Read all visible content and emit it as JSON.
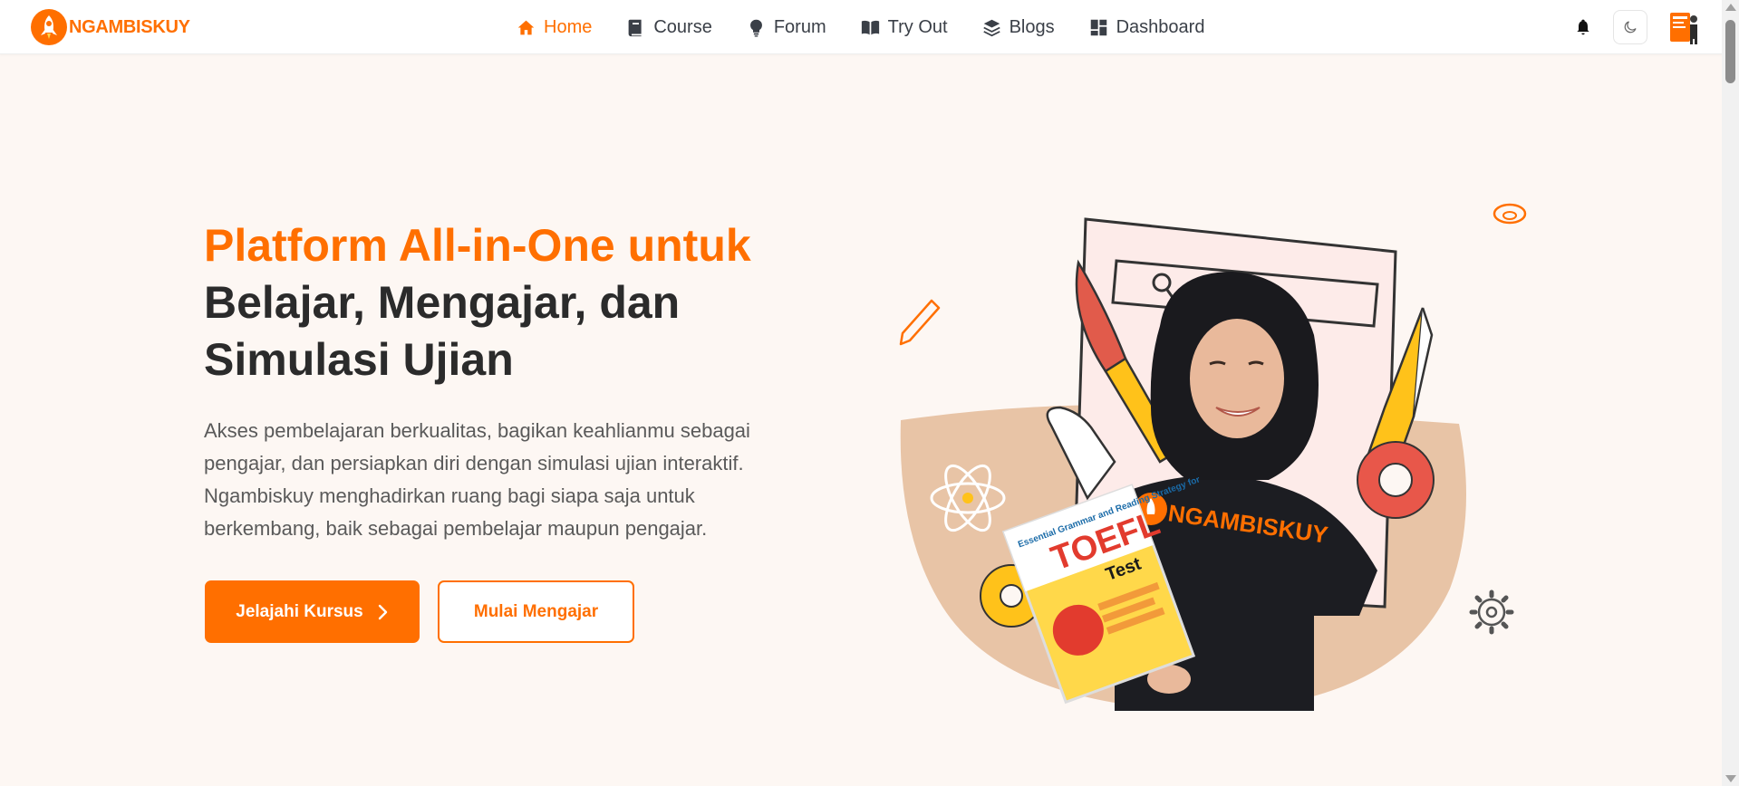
{
  "brand": {
    "name": "NGAMBISKUY",
    "color": "#ff6f00"
  },
  "nav": {
    "items": [
      {
        "label": "Home",
        "icon": "home-icon",
        "active": true
      },
      {
        "label": "Course",
        "icon": "book-icon",
        "active": false
      },
      {
        "label": "Forum",
        "icon": "lightbulb-icon",
        "active": false
      },
      {
        "label": "Try Out",
        "icon": "open-book-icon",
        "active": false
      },
      {
        "label": "Blogs",
        "icon": "layers-icon",
        "active": false
      },
      {
        "label": "Dashboard",
        "icon": "dashboard-icon",
        "active": false
      }
    ],
    "right_icons": [
      "bell-icon",
      "moon-icon",
      "avatar"
    ]
  },
  "hero": {
    "title_accent": "Platform All-in-One untuk",
    "title_rest": "Belajar, Mengajar, dan Simulasi Ujian",
    "description": "Akses pembelajaran berkualitas, bagikan keahlianmu sebagai pengajar, dan persiapkan diri dengan simulasi ujian interaktif. Ngambiskuy menghadirkan ruang bagi siapa saja untuk berkembang, baik sebagai pembelajar maupun pengajar.",
    "primary_button": "Jelajahi Kursus",
    "secondary_button": "Mulai Mengajar"
  },
  "illustration": {
    "shirt_text": "NGAMBISKUY",
    "book_title": "TOEFL",
    "book_subtitle": "Test",
    "book_heading": "Essential Grammar and Reading Strategy for"
  },
  "colors": {
    "accent": "#ff6f00",
    "background": "#fdf7f3",
    "blob": "#e8c4a6"
  }
}
